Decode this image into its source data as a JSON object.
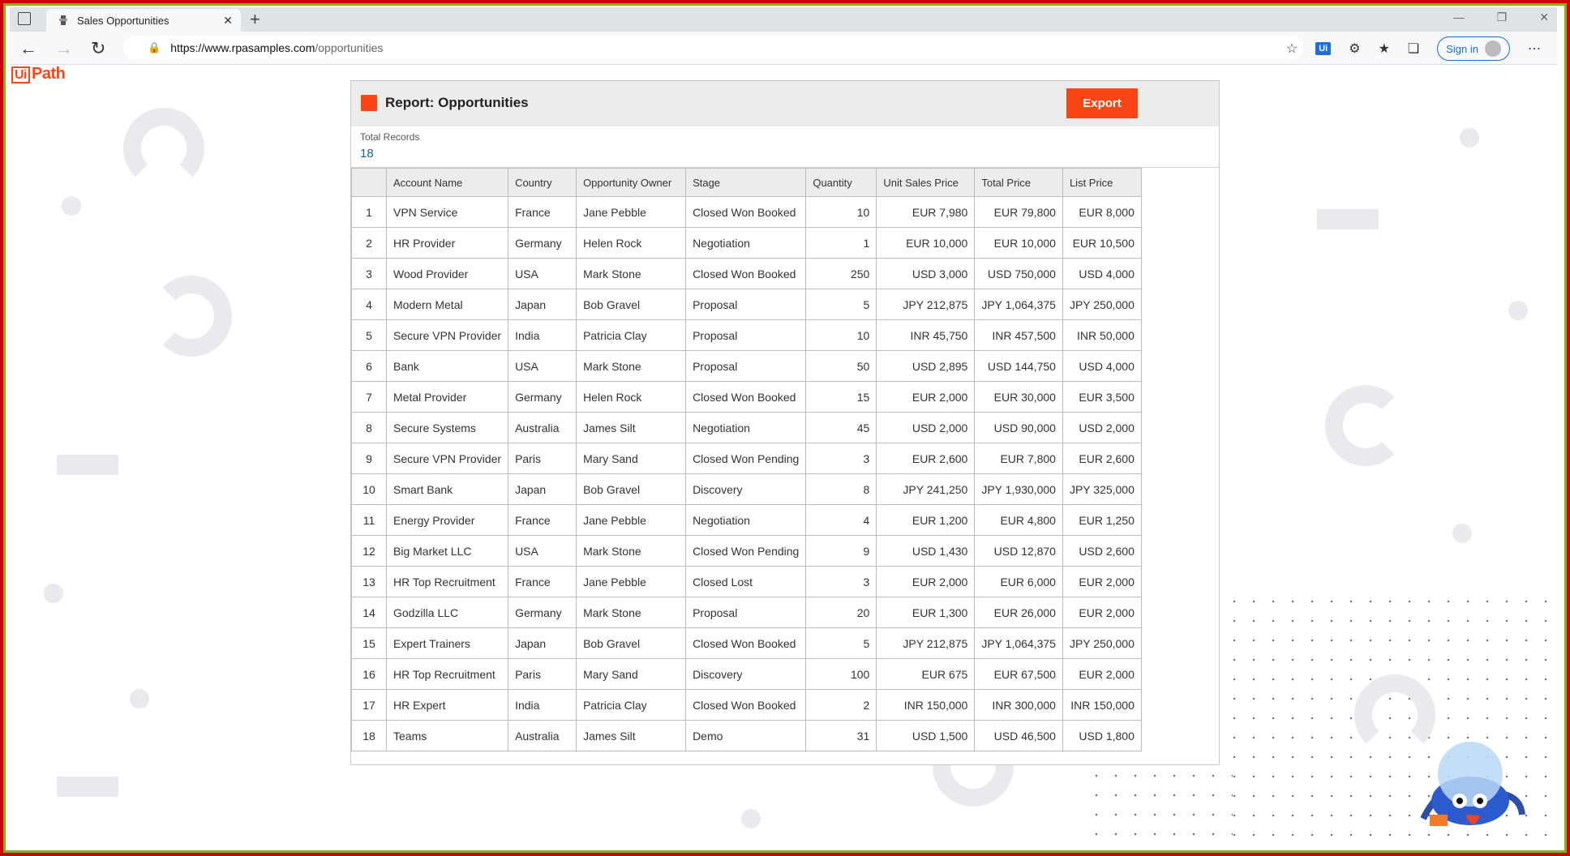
{
  "browser": {
    "tab_title": "Sales Opportunities",
    "new_tab": "+",
    "url_host": "https://www.rpasamples.com",
    "url_path": "/opportunities",
    "signin_label": "Sign in",
    "ui_badge": "Ui"
  },
  "logo": {
    "ui": "Ui",
    "text": "Path"
  },
  "report": {
    "title": "Report: Opportunities",
    "export_label": "Export",
    "total_label": "Total Records",
    "total_value": "18"
  },
  "table": {
    "columns": [
      "",
      "Account Name",
      "Country",
      "Opportunity Owner",
      "Stage",
      "Quantity",
      "Unit Sales Price",
      "Total Price",
      "List Price"
    ],
    "rows": [
      [
        "1",
        "VPN Service",
        "France",
        "Jane Pebble",
        "Closed Won Booked",
        "10",
        "EUR 7,980",
        "EUR 79,800",
        "EUR 8,000"
      ],
      [
        "2",
        "HR Provider",
        "Germany",
        "Helen Rock",
        "Negotiation",
        "1",
        "EUR 10,000",
        "EUR 10,000",
        "EUR 10,500"
      ],
      [
        "3",
        "Wood Provider",
        "USA",
        "Mark Stone",
        "Closed Won Booked",
        "250",
        "USD 3,000",
        "USD 750,000",
        "USD 4,000"
      ],
      [
        "4",
        "Modern Metal",
        "Japan",
        "Bob Gravel",
        "Proposal",
        "5",
        "JPY 212,875",
        "JPY 1,064,375",
        "JPY 250,000"
      ],
      [
        "5",
        "Secure VPN Provider",
        "India",
        "Patricia Clay",
        "Proposal",
        "10",
        "INR 45,750",
        "INR 457,500",
        "INR 50,000"
      ],
      [
        "6",
        "Bank",
        "USA",
        "Mark Stone",
        "Proposal",
        "50",
        "USD 2,895",
        "USD 144,750",
        "USD 4,000"
      ],
      [
        "7",
        "Metal Provider",
        "Germany",
        "Helen Rock",
        "Closed Won Booked",
        "15",
        "EUR 2,000",
        "EUR 30,000",
        "EUR 3,500"
      ],
      [
        "8",
        "Secure Systems",
        "Australia",
        "James Silt",
        "Negotiation",
        "45",
        "USD 2,000",
        "USD 90,000",
        "USD 2,000"
      ],
      [
        "9",
        "Secure VPN Provider",
        "Paris",
        "Mary Sand",
        "Closed Won Pending",
        "3",
        "EUR 2,600",
        "EUR 7,800",
        "EUR 2,600"
      ],
      [
        "10",
        "Smart Bank",
        "Japan",
        "Bob Gravel",
        "Discovery",
        "8",
        "JPY 241,250",
        "JPY 1,930,000",
        "JPY 325,000"
      ],
      [
        "11",
        "Energy Provider",
        "France",
        "Jane Pebble",
        "Negotiation",
        "4",
        "EUR 1,200",
        "EUR 4,800",
        "EUR 1,250"
      ],
      [
        "12",
        "Big Market LLC",
        "USA",
        "Mark Stone",
        "Closed Won Pending",
        "9",
        "USD 1,430",
        "USD 12,870",
        "USD 2,600"
      ],
      [
        "13",
        "HR Top Recruitment",
        "France",
        "Jane Pebble",
        "Closed Lost",
        "3",
        "EUR 2,000",
        "EUR 6,000",
        "EUR 2,000"
      ],
      [
        "14",
        "Godzilla LLC",
        "Germany",
        "Mark Stone",
        "Proposal",
        "20",
        "EUR 1,300",
        "EUR 26,000",
        "EUR 2,000"
      ],
      [
        "15",
        "Expert Trainers",
        "Japan",
        "Bob Gravel",
        "Closed Won Booked",
        "5",
        "JPY 212,875",
        "JPY 1,064,375",
        "JPY 250,000"
      ],
      [
        "16",
        "HR Top Recruitment",
        "Paris",
        "Mary Sand",
        "Discovery",
        "100",
        "EUR 675",
        "EUR 67,500",
        "EUR 2,000"
      ],
      [
        "17",
        "HR Expert",
        "India",
        "Patricia Clay",
        "Closed Won Booked",
        "2",
        "INR 150,000",
        "INR 300,000",
        "INR 150,000"
      ],
      [
        "18",
        "Teams",
        "Australia",
        "James Silt",
        "Demo",
        "31",
        "USD 1,500",
        "USD 46,500",
        "USD 1,800"
      ]
    ]
  },
  "colors": {
    "accent": "#fa4616",
    "link": "#1d5aa8"
  }
}
